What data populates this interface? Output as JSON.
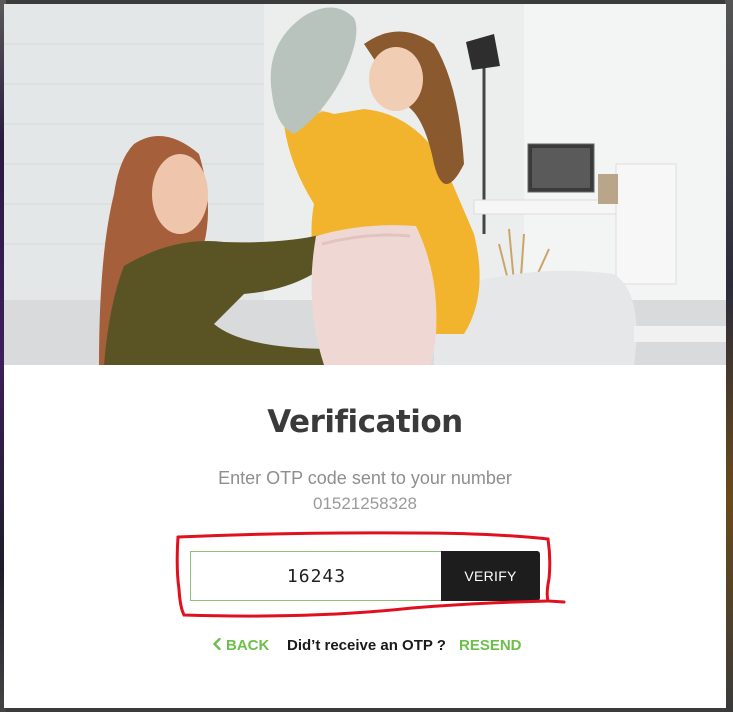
{
  "modal": {
    "title": "Verification",
    "subtitle": "Enter OTP code sent to your number",
    "phone_number": "01521258328"
  },
  "otp": {
    "value": "16243",
    "verify_label": "VERIFY"
  },
  "footer": {
    "back_label": "BACK",
    "prompt": "Did’t receive an OTP ?",
    "resend_label": "RESEND"
  },
  "colors": {
    "accent_green": "#6cbf4a",
    "button_dark": "#1d1d1d",
    "annotation_red": "#e0101e"
  },
  "icons": {
    "back": "chevron-left-icon"
  }
}
